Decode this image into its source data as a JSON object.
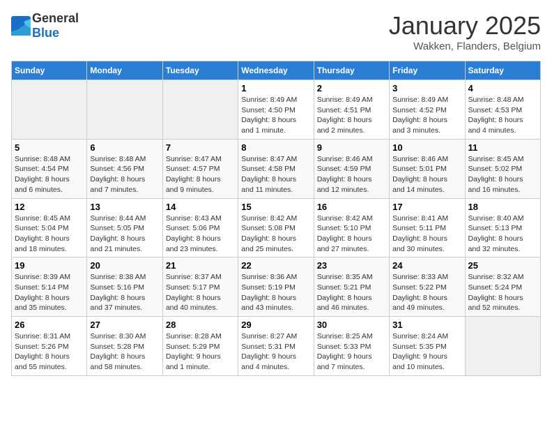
{
  "logo": {
    "general": "General",
    "blue": "Blue"
  },
  "title": "January 2025",
  "location": "Wakken, Flanders, Belgium",
  "days_of_week": [
    "Sunday",
    "Monday",
    "Tuesday",
    "Wednesday",
    "Thursday",
    "Friday",
    "Saturday"
  ],
  "weeks": [
    [
      {
        "day": "",
        "info": ""
      },
      {
        "day": "",
        "info": ""
      },
      {
        "day": "",
        "info": ""
      },
      {
        "day": "1",
        "info": "Sunrise: 8:49 AM\nSunset: 4:50 PM\nDaylight: 8 hours\nand 1 minute."
      },
      {
        "day": "2",
        "info": "Sunrise: 8:49 AM\nSunset: 4:51 PM\nDaylight: 8 hours\nand 2 minutes."
      },
      {
        "day": "3",
        "info": "Sunrise: 8:49 AM\nSunset: 4:52 PM\nDaylight: 8 hours\nand 3 minutes."
      },
      {
        "day": "4",
        "info": "Sunrise: 8:48 AM\nSunset: 4:53 PM\nDaylight: 8 hours\nand 4 minutes."
      }
    ],
    [
      {
        "day": "5",
        "info": "Sunrise: 8:48 AM\nSunset: 4:54 PM\nDaylight: 8 hours\nand 6 minutes."
      },
      {
        "day": "6",
        "info": "Sunrise: 8:48 AM\nSunset: 4:56 PM\nDaylight: 8 hours\nand 7 minutes."
      },
      {
        "day": "7",
        "info": "Sunrise: 8:47 AM\nSunset: 4:57 PM\nDaylight: 8 hours\nand 9 minutes."
      },
      {
        "day": "8",
        "info": "Sunrise: 8:47 AM\nSunset: 4:58 PM\nDaylight: 8 hours\nand 11 minutes."
      },
      {
        "day": "9",
        "info": "Sunrise: 8:46 AM\nSunset: 4:59 PM\nDaylight: 8 hours\nand 12 minutes."
      },
      {
        "day": "10",
        "info": "Sunrise: 8:46 AM\nSunset: 5:01 PM\nDaylight: 8 hours\nand 14 minutes."
      },
      {
        "day": "11",
        "info": "Sunrise: 8:45 AM\nSunset: 5:02 PM\nDaylight: 8 hours\nand 16 minutes."
      }
    ],
    [
      {
        "day": "12",
        "info": "Sunrise: 8:45 AM\nSunset: 5:04 PM\nDaylight: 8 hours\nand 18 minutes."
      },
      {
        "day": "13",
        "info": "Sunrise: 8:44 AM\nSunset: 5:05 PM\nDaylight: 8 hours\nand 21 minutes."
      },
      {
        "day": "14",
        "info": "Sunrise: 8:43 AM\nSunset: 5:06 PM\nDaylight: 8 hours\nand 23 minutes."
      },
      {
        "day": "15",
        "info": "Sunrise: 8:42 AM\nSunset: 5:08 PM\nDaylight: 8 hours\nand 25 minutes."
      },
      {
        "day": "16",
        "info": "Sunrise: 8:42 AM\nSunset: 5:10 PM\nDaylight: 8 hours\nand 27 minutes."
      },
      {
        "day": "17",
        "info": "Sunrise: 8:41 AM\nSunset: 5:11 PM\nDaylight: 8 hours\nand 30 minutes."
      },
      {
        "day": "18",
        "info": "Sunrise: 8:40 AM\nSunset: 5:13 PM\nDaylight: 8 hours\nand 32 minutes."
      }
    ],
    [
      {
        "day": "19",
        "info": "Sunrise: 8:39 AM\nSunset: 5:14 PM\nDaylight: 8 hours\nand 35 minutes."
      },
      {
        "day": "20",
        "info": "Sunrise: 8:38 AM\nSunset: 5:16 PM\nDaylight: 8 hours\nand 37 minutes."
      },
      {
        "day": "21",
        "info": "Sunrise: 8:37 AM\nSunset: 5:17 PM\nDaylight: 8 hours\nand 40 minutes."
      },
      {
        "day": "22",
        "info": "Sunrise: 8:36 AM\nSunset: 5:19 PM\nDaylight: 8 hours\nand 43 minutes."
      },
      {
        "day": "23",
        "info": "Sunrise: 8:35 AM\nSunset: 5:21 PM\nDaylight: 8 hours\nand 46 minutes."
      },
      {
        "day": "24",
        "info": "Sunrise: 8:33 AM\nSunset: 5:22 PM\nDaylight: 8 hours\nand 49 minutes."
      },
      {
        "day": "25",
        "info": "Sunrise: 8:32 AM\nSunset: 5:24 PM\nDaylight: 8 hours\nand 52 minutes."
      }
    ],
    [
      {
        "day": "26",
        "info": "Sunrise: 8:31 AM\nSunset: 5:26 PM\nDaylight: 8 hours\nand 55 minutes."
      },
      {
        "day": "27",
        "info": "Sunrise: 8:30 AM\nSunset: 5:28 PM\nDaylight: 8 hours\nand 58 minutes."
      },
      {
        "day": "28",
        "info": "Sunrise: 8:28 AM\nSunset: 5:29 PM\nDaylight: 9 hours\nand 1 minute."
      },
      {
        "day": "29",
        "info": "Sunrise: 8:27 AM\nSunset: 5:31 PM\nDaylight: 9 hours\nand 4 minutes."
      },
      {
        "day": "30",
        "info": "Sunrise: 8:25 AM\nSunset: 5:33 PM\nDaylight: 9 hours\nand 7 minutes."
      },
      {
        "day": "31",
        "info": "Sunrise: 8:24 AM\nSunset: 5:35 PM\nDaylight: 9 hours\nand 10 minutes."
      },
      {
        "day": "",
        "info": ""
      }
    ]
  ]
}
